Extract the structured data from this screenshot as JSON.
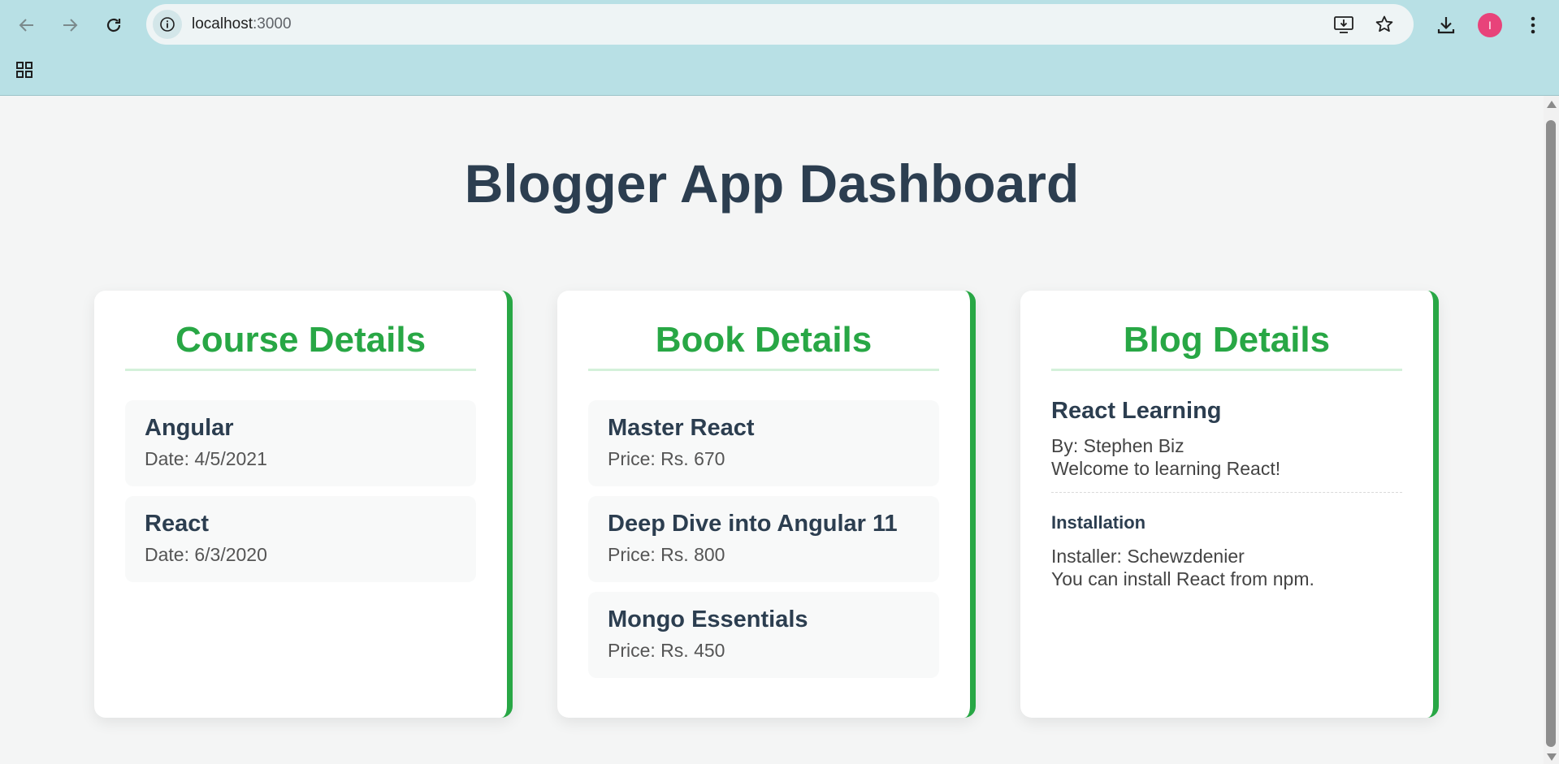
{
  "browser": {
    "url_host": "localhost",
    "url_port": ":3000",
    "avatar_letter": "I"
  },
  "page": {
    "title": "Blogger App Dashboard"
  },
  "courses": {
    "heading": "Course Details",
    "items": [
      {
        "name": "Angular",
        "meta": "Date: 4/5/2021"
      },
      {
        "name": "React",
        "meta": "Date: 6/3/2020"
      }
    ]
  },
  "books": {
    "heading": "Book Details",
    "items": [
      {
        "name": "Master React",
        "meta": "Price: Rs. 670"
      },
      {
        "name": "Deep Dive into Angular 11",
        "meta": "Price: Rs. 800"
      },
      {
        "name": "Mongo Essentials",
        "meta": "Price: Rs. 450"
      }
    ]
  },
  "blogs": {
    "heading": "Blog Details",
    "items": [
      {
        "title": "React Learning",
        "author": "By: Stephen Biz",
        "text": "Welcome to learning React!"
      },
      {
        "title": "Installation",
        "author": "Installer: Schewzdenier",
        "text": "You can install React from npm."
      }
    ]
  },
  "colors": {
    "accent": "#28a745",
    "heading": "#2c3e50",
    "chrome": "#b8e0e5"
  }
}
